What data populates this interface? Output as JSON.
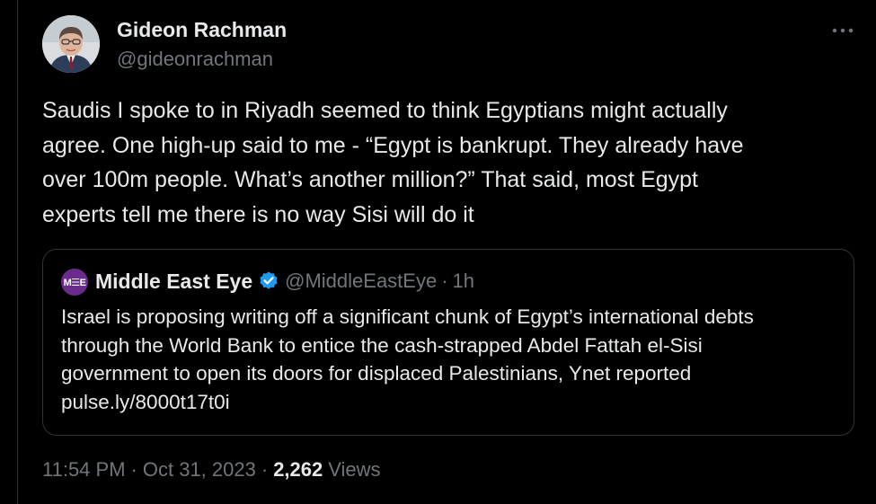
{
  "tweet": {
    "display_name": "Gideon Rachman",
    "handle": "@gideonrachman",
    "text": "Saudis I spoke to in Riyadh seemed to think Egyptians might actually\nagree. One high-up said to me - “Egypt is bankrupt. They already have\nover 100m people. What’s another million?” That said, most Egypt\nexperts tell me there is no way Sisi will do it",
    "more_icon": "more-horizontal-icon"
  },
  "quote": {
    "avatar_text": "M☰E",
    "display_name": "Middle East Eye",
    "verified_icon": "verified-badge-icon",
    "handle": "@MiddleEastEye",
    "separator": "·",
    "time": "1h",
    "text": "Israel is proposing writing off a significant chunk of Egypt’s international debts\nthrough the World Bank to entice the cash-strapped Abdel Fattah el-Sisi\ngovernment to open its doors for displaced Palestinians, Ynet reported\npulse.ly/8000t17t0i"
  },
  "meta": {
    "time": "11:54 PM",
    "separator": "·",
    "date": "Oct 31, 2023",
    "views_count": "2,262",
    "views_label": "Views"
  },
  "colors": {
    "background": "#000000",
    "text_primary": "#e7e9ea",
    "text_secondary": "#71767b",
    "border": "#2f3336",
    "verified": "#1d9bf0",
    "mee_brand": "#6b2b8c"
  }
}
